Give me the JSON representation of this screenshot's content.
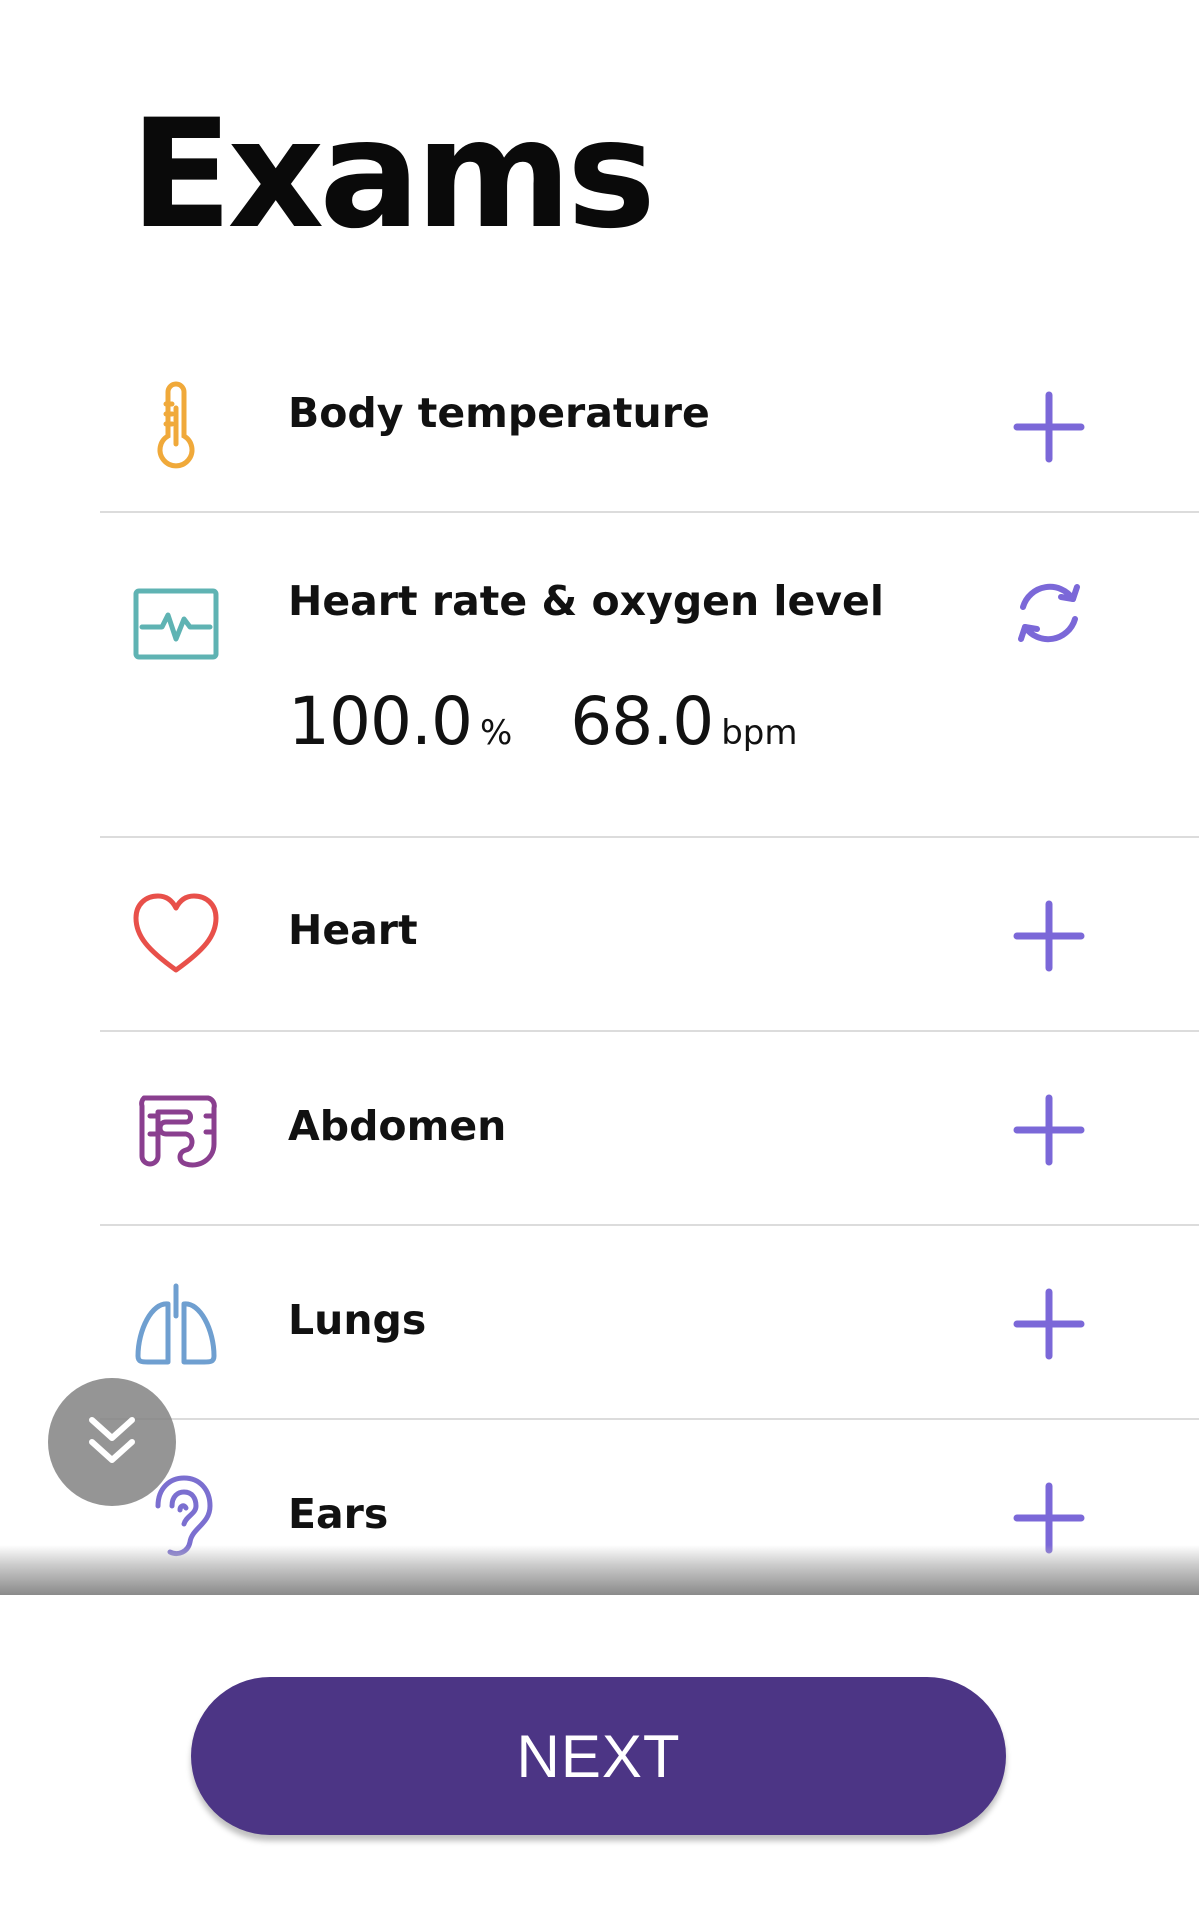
{
  "page": {
    "title": "Exams"
  },
  "exams": [
    {
      "label": "Body temperature",
      "icon": "thermometer-icon",
      "icon_color": "#f0a93a",
      "action": "plus-icon"
    },
    {
      "label": "Heart rate & oxygen level",
      "icon": "pulse-monitor-icon",
      "icon_color": "#5fb3b3",
      "action": "refresh-icon",
      "readings": [
        {
          "value": "100.0",
          "unit": "%"
        },
        {
          "value": "68.0",
          "unit": "bpm"
        }
      ]
    },
    {
      "label": "Heart",
      "icon": "heart-icon",
      "icon_color": "#e8504a",
      "action": "plus-icon"
    },
    {
      "label": "Abdomen",
      "icon": "intestine-icon",
      "icon_color": "#8a3f8f",
      "action": "plus-icon"
    },
    {
      "label": "Lungs",
      "icon": "lungs-icon",
      "icon_color": "#6f9fd0",
      "action": "plus-icon"
    },
    {
      "label": "Ears",
      "icon": "ear-icon",
      "icon_color": "#7b6fd0",
      "action": "plus-icon"
    }
  ],
  "colors": {
    "accent": "#7b68d8",
    "primary_button": "#4c3585"
  },
  "footer": {
    "next_label": "NEXT"
  },
  "scroll_button": {
    "icon": "double-chevron-down-icon"
  }
}
